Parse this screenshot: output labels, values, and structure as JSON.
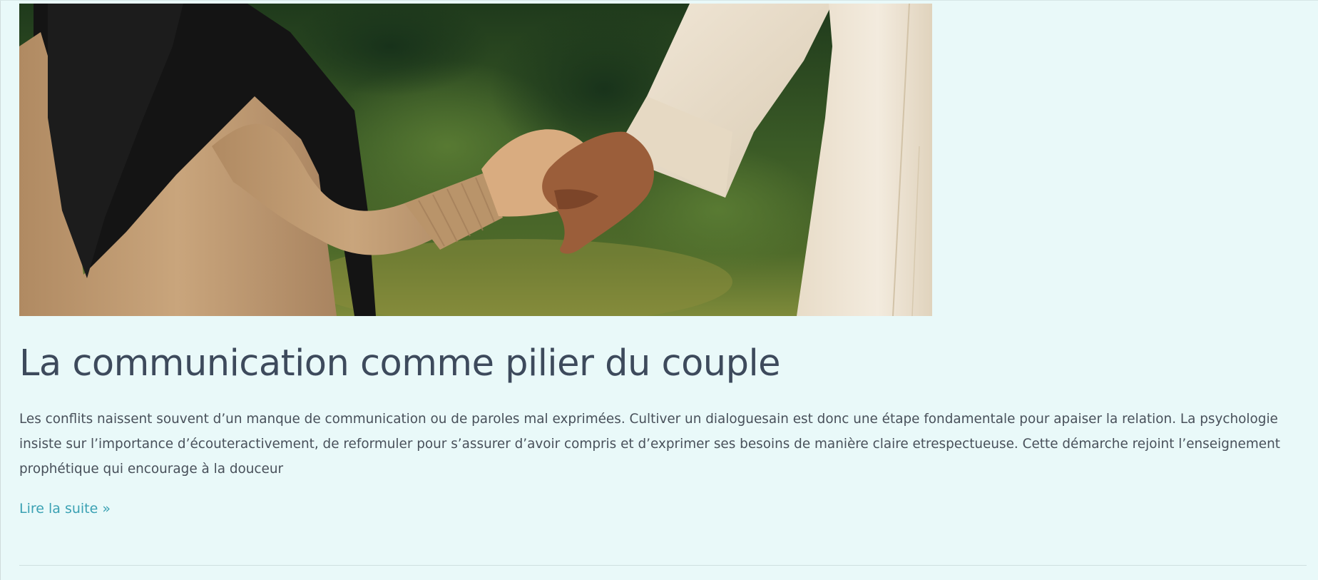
{
  "article": {
    "image_description": "",
    "title": "La communication comme pilier du couple",
    "excerpt": "Les conflits naissent souvent d’un manque de communication ou de paroles mal exprimées. Cultiver un dialoguesain est donc une étape fondamentale pour apaiser la relation. La psychologie insiste sur l’importance d’écouteractivement, de reformuler pour s’assurer d’avoir compris et d’exprimer ses besoins de manière claire etrespectueuse. Cette démarche rejoint l’enseignement prophétique qui encourage à la douceur",
    "read_more": "Lire la suite »"
  },
  "colors": {
    "background": "#e9f9f9",
    "title": "#3d4a5c",
    "text": "#48505a",
    "link": "#3aa1b3"
  }
}
